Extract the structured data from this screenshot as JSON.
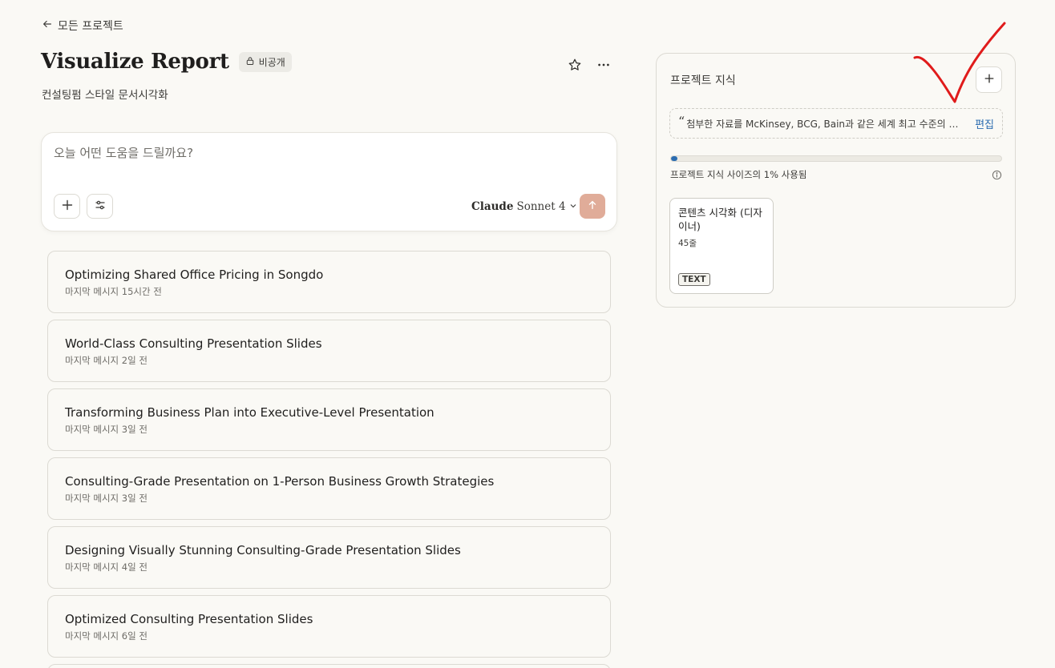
{
  "nav": {
    "back_label": "모든 프로젝트"
  },
  "project": {
    "title": "Visualize Report",
    "visibility": "비공개",
    "description": "컨설팅펌 스타일 문서시각화"
  },
  "composer": {
    "placeholder": "오늘 어떤 도움을 드릴까요?",
    "model_brand": "Claude",
    "model_name": "Sonnet 4"
  },
  "chats": [
    {
      "title": "Optimizing Shared Office Pricing in Songdo",
      "meta": "마지막 메시지 15시간 전"
    },
    {
      "title": "World-Class Consulting Presentation Slides",
      "meta": "마지막 메시지 2일 전"
    },
    {
      "title": "Transforming Business Plan into Executive-Level Presentation",
      "meta": "마지막 메시지 3일 전"
    },
    {
      "title": "Consulting-Grade Presentation on 1-Person Business Growth Strategies",
      "meta": "마지막 메시지 3일 전"
    },
    {
      "title": "Designing Visually Stunning Consulting-Grade Presentation Slides",
      "meta": "마지막 메시지 4일 전"
    },
    {
      "title": "Optimized Consulting Presentation Slides",
      "meta": "마지막 메시지 6일 전"
    }
  ],
  "knowledge": {
    "title": "프로젝트 지식",
    "instructions": "첨부한 자료를 McKinsey, BCG, Bain과 같은 세계 최고 수준의 컨...",
    "edit_label": "편집",
    "usage_fraction": 0.01,
    "usage_label": "프로젝트 지식 사이즈의 1% 사용됨",
    "files": [
      {
        "name": "콘텐츠 시각화 (디자이너)",
        "lines": "45줄",
        "type": "TEXT"
      }
    ]
  },
  "colors": {
    "background": "#faf9f5",
    "send_button": "#e0ac99",
    "link": "#2b6cb0",
    "annotation": "#e01b1b"
  }
}
